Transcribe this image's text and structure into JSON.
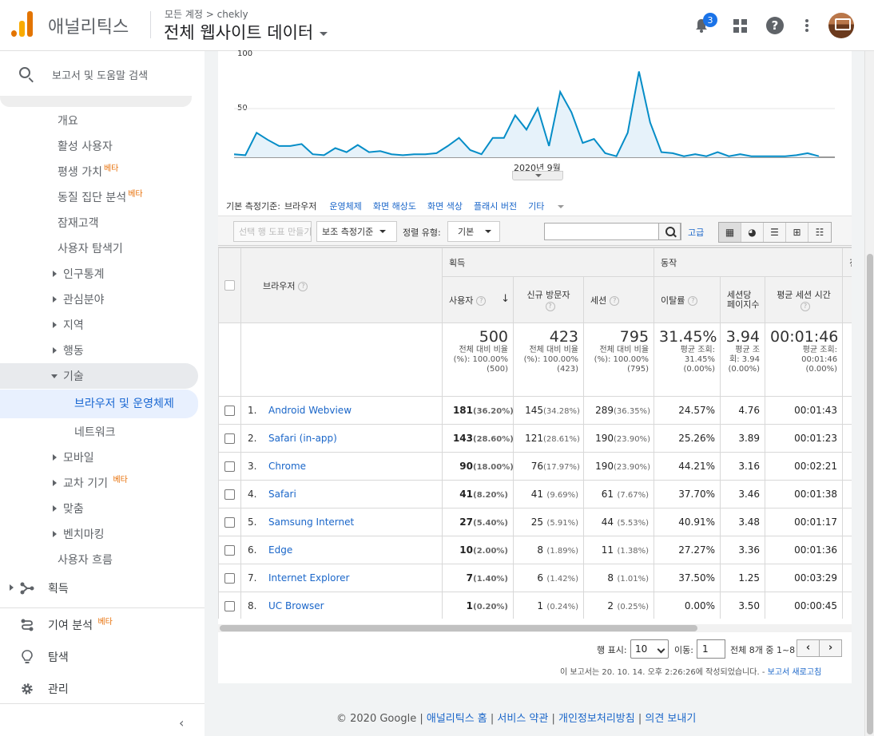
{
  "header": {
    "app_name": "애널리틱스",
    "breadcrumb": "모든 계정 > chekly",
    "property_title": "전체 웹사이트 데이터",
    "notification_count": "3"
  },
  "sidebar": {
    "search_label": "보고서 및 도움말 검색",
    "beta": "베타",
    "items": [
      {
        "label": "개요"
      },
      {
        "label": "활성 사용자"
      },
      {
        "label": "평생 가치"
      },
      {
        "label": "동질 집단 분석"
      },
      {
        "label": "잠재고객"
      },
      {
        "label": "사용자 탐색기"
      },
      {
        "label": "인구통계"
      },
      {
        "label": "관심분야"
      },
      {
        "label": "지역"
      },
      {
        "label": "행동"
      },
      {
        "label": "기술"
      },
      {
        "label": "브라우저 및 운영체제"
      },
      {
        "label": "네트워크"
      },
      {
        "label": "모바일"
      },
      {
        "label": "교차 기기"
      },
      {
        "label": "맞춤"
      },
      {
        "label": "벤치마킹"
      },
      {
        "label": "사용자 흐름"
      }
    ],
    "sections": [
      {
        "label": "획득",
        "icon": "acquisition-icon"
      },
      {
        "label": "기여 분석",
        "icon": "attribution-icon"
      },
      {
        "label": "탐색",
        "icon": "lightbulb-icon"
      },
      {
        "label": "관리",
        "icon": "gear-icon"
      }
    ]
  },
  "chart_data": {
    "type": "area",
    "color": "#058dc7",
    "yticks": [
      "100",
      "50"
    ],
    "ylim": [
      0,
      100
    ],
    "xlabel": "2020년 9월",
    "values": [
      3,
      2,
      24,
      17,
      11,
      11,
      13,
      3,
      2,
      9,
      5,
      12,
      5,
      6,
      3,
      2,
      3,
      3,
      4,
      11,
      19,
      7,
      3,
      19,
      19,
      41,
      27,
      48,
      11,
      64,
      44,
      14,
      18,
      4,
      1,
      24,
      84,
      34,
      5,
      4,
      1,
      3,
      1,
      5,
      1,
      3,
      1,
      1,
      1,
      1,
      2,
      4,
      1
    ]
  },
  "dimension_bar": {
    "label": "기본 측정기준:",
    "current": "브라우저",
    "links": [
      "운영체제",
      "화면 해상도",
      "화면 색상",
      "플래시 버전",
      "기타"
    ]
  },
  "toolbar": {
    "plot_rows": "선택 행 도표 만들기",
    "secondary_dim": "보조 측정기준",
    "sort_type_label": "정렬 유형:",
    "sort_type_value": "기본",
    "advanced": "고급",
    "search_value": ""
  },
  "table": {
    "group_acq": "획득",
    "group_beh": "동작",
    "group_conv": "전",
    "dim_header": "브라우저",
    "columns": [
      "사용자",
      "신규 방문자",
      "세션",
      "이탈률",
      "세션당 페이지수",
      "평균 세션 시간"
    ],
    "totals": [
      {
        "value": "500",
        "sub": "전체 대비 비율(%): 100.00% (500)"
      },
      {
        "value": "423",
        "sub": "전체 대비 비율(%): 100.00% (423)"
      },
      {
        "value": "795",
        "sub": "전체 대비 비율(%): 100.00% (795)"
      },
      {
        "value": "31.45%",
        "sub": "평균 조회: 31.45% (0.00%)"
      },
      {
        "value": "3.94",
        "sub": "평균 조회: 3.94 (0.00%)"
      },
      {
        "value": "00:01:46",
        "sub": "평균 조회: 00:01:46 (0.00%)"
      }
    ],
    "rows": [
      {
        "idx": "1.",
        "name": "Android Webview",
        "users": "181",
        "users_pct": "(36.20%)",
        "new": "145",
        "new_pct": "(34.28%)",
        "sessions": "289",
        "sessions_pct": "(36.35%)",
        "bounce": "24.57%",
        "pps": "4.76",
        "dur": "00:01:43"
      },
      {
        "idx": "2.",
        "name": "Safari (in-app)",
        "users": "143",
        "users_pct": "(28.60%)",
        "new": "121",
        "new_pct": "(28.61%)",
        "sessions": "190",
        "sessions_pct": "(23.90%)",
        "bounce": "25.26%",
        "pps": "3.89",
        "dur": "00:01:23"
      },
      {
        "idx": "3.",
        "name": "Chrome",
        "users": "90",
        "users_pct": "(18.00%)",
        "new": "76",
        "new_pct": "(17.97%)",
        "sessions": "190",
        "sessions_pct": "(23.90%)",
        "bounce": "44.21%",
        "pps": "3.16",
        "dur": "00:02:21"
      },
      {
        "idx": "4.",
        "name": "Safari",
        "users": "41",
        "users_pct": "(8.20%)",
        "new": "41",
        "new_pct": "(9.69%)",
        "sessions": "61",
        "sessions_pct": "(7.67%)",
        "bounce": "37.70%",
        "pps": "3.46",
        "dur": "00:01:38"
      },
      {
        "idx": "5.",
        "name": "Samsung Internet",
        "users": "27",
        "users_pct": "(5.40%)",
        "new": "25",
        "new_pct": "(5.91%)",
        "sessions": "44",
        "sessions_pct": "(5.53%)",
        "bounce": "40.91%",
        "pps": "3.48",
        "dur": "00:01:17"
      },
      {
        "idx": "6.",
        "name": "Edge",
        "users": "10",
        "users_pct": "(2.00%)",
        "new": "8",
        "new_pct": "(1.89%)",
        "sessions": "11",
        "sessions_pct": "(1.38%)",
        "bounce": "27.27%",
        "pps": "3.36",
        "dur": "00:01:36"
      },
      {
        "idx": "7.",
        "name": "Internet Explorer",
        "users": "7",
        "users_pct": "(1.40%)",
        "new": "6",
        "new_pct": "(1.42%)",
        "sessions": "8",
        "sessions_pct": "(1.01%)",
        "bounce": "37.50%",
        "pps": "1.25",
        "dur": "00:03:29"
      },
      {
        "idx": "8.",
        "name": "UC Browser",
        "users": "1",
        "users_pct": "(0.20%)",
        "new": "1",
        "new_pct": "(0.24%)",
        "sessions": "2",
        "sessions_pct": "(0.25%)",
        "bounce": "0.00%",
        "pps": "3.50",
        "dur": "00:00:45"
      }
    ]
  },
  "pagination": {
    "rows_label": "행 표시:",
    "rows_value": "10",
    "goto_label": "이동:",
    "goto_value": "1",
    "range": "전체 8개 중 1~8",
    "prev": "‹",
    "next": "›"
  },
  "report_note": {
    "text": "이 보고서는 20. 10. 14. 오후 2:26:26에 작성되었습니다. - ",
    "link": "보고서 새로고침"
  },
  "footer": {
    "copyright": "© 2020 Google",
    "links": [
      "애널리틱스 홈",
      "서비스 약관",
      "개인정보처리방침",
      "의견 보내기"
    ]
  }
}
